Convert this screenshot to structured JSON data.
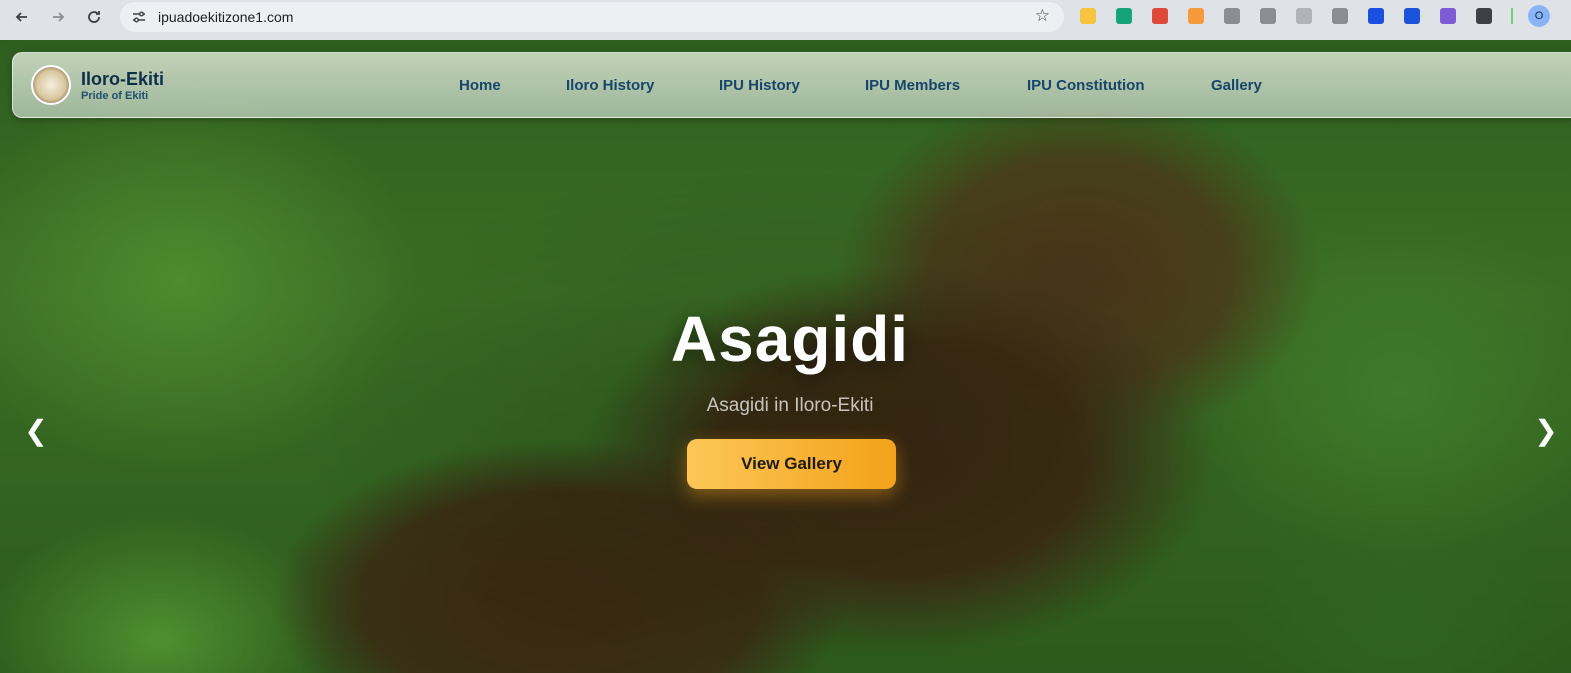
{
  "browser": {
    "url": "ipuadoekitizone1.com",
    "profile_initial": "O",
    "back_icon": "arrow-left-icon",
    "forward_icon": "arrow-right-icon",
    "reload_icon": "reload-icon",
    "extensions": [
      {
        "name": "sticky-note-extension-icon",
        "color": "#f5c542"
      },
      {
        "name": "grammarly-extension-icon",
        "color": "#15a37a"
      },
      {
        "name": "megaphone-extension-icon",
        "color": "#e0483a"
      },
      {
        "name": "orange-box-extension-icon",
        "color": "#f59a38"
      },
      {
        "name": "camera-extension-icon",
        "color": "#8a8d91"
      },
      {
        "name": "chat-extension-icon",
        "color": "#8a8d91"
      },
      {
        "name": "compass-extension-icon",
        "color": "#b0b3b7"
      },
      {
        "name": "shield-extension-icon",
        "color": "#8a8d91"
      },
      {
        "name": "blue-cursor-extension-icon",
        "color": "#1b4fe0"
      },
      {
        "name": "blue-shield-extension-icon",
        "color": "#1a54d8"
      },
      {
        "name": "lock-diamond-extension-icon",
        "color": "#7c5bd6"
      },
      {
        "name": "puzzle-extension-icon",
        "color": "#3c4043"
      }
    ]
  },
  "site": {
    "brand_name": "Iloro-Ekiti",
    "brand_tagline": "Pride of Ekiti",
    "nav": [
      {
        "label": "Home"
      },
      {
        "label": "Iloro History"
      },
      {
        "label": "IPU History"
      },
      {
        "label": "IPU Members"
      },
      {
        "label": "IPU Constitution"
      },
      {
        "label": "Gallery"
      }
    ]
  },
  "slide": {
    "title": "Asagidi",
    "subtitle": "Asagidi in Iloro-Ekiti",
    "cta_label": "View Gallery",
    "prev_glyph": "❮",
    "next_glyph": "❯"
  },
  "colors": {
    "cta_start": "#fcc757",
    "cta_end": "#f3a21a",
    "nav_text": "#17456b"
  }
}
